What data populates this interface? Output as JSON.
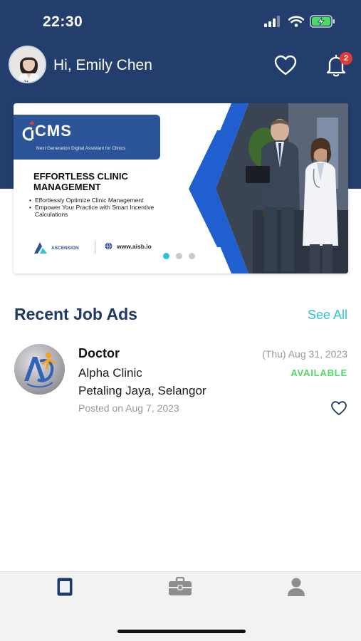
{
  "status_bar": {
    "time": "22:30"
  },
  "header": {
    "greeting": "Hi, Emily Chen",
    "notification_count": "2"
  },
  "banner": {
    "brand": "CMS",
    "tagline": "Next Generation Digital Assistant for Clinics",
    "heading": "EFFORTLESS CLINIC MANAGEMENT",
    "bullets": [
      "Effortlessly Optimize Clinic Management",
      "Empower Your Practice with Smart Incentive Calculations"
    ],
    "company": "ASCENSION",
    "website": "www.aisb.io",
    "active_slide": 1,
    "slide_count": 3
  },
  "section": {
    "title": "Recent Job Ads",
    "see_all": "See All"
  },
  "jobs": [
    {
      "title": "Doctor",
      "clinic": "Alpha Clinic",
      "location": "Petaling Jaya, Selangor",
      "posted": "Posted on Aug 7, 2023",
      "date": "(Thu) Aug 31, 2023",
      "status": "AVAILABLE"
    }
  ],
  "colors": {
    "header_bg": "#233e6d",
    "accent": "#2ec4d6",
    "title": "#1e3a68",
    "available": "#4cd964",
    "badge": "#e53935"
  },
  "icons": {
    "status": [
      "signal-icon",
      "wifi-icon",
      "battery-charging-icon"
    ],
    "header": [
      "heart-icon",
      "bell-icon"
    ],
    "tabs": [
      "document-icon",
      "briefcase-icon",
      "person-icon"
    ]
  }
}
